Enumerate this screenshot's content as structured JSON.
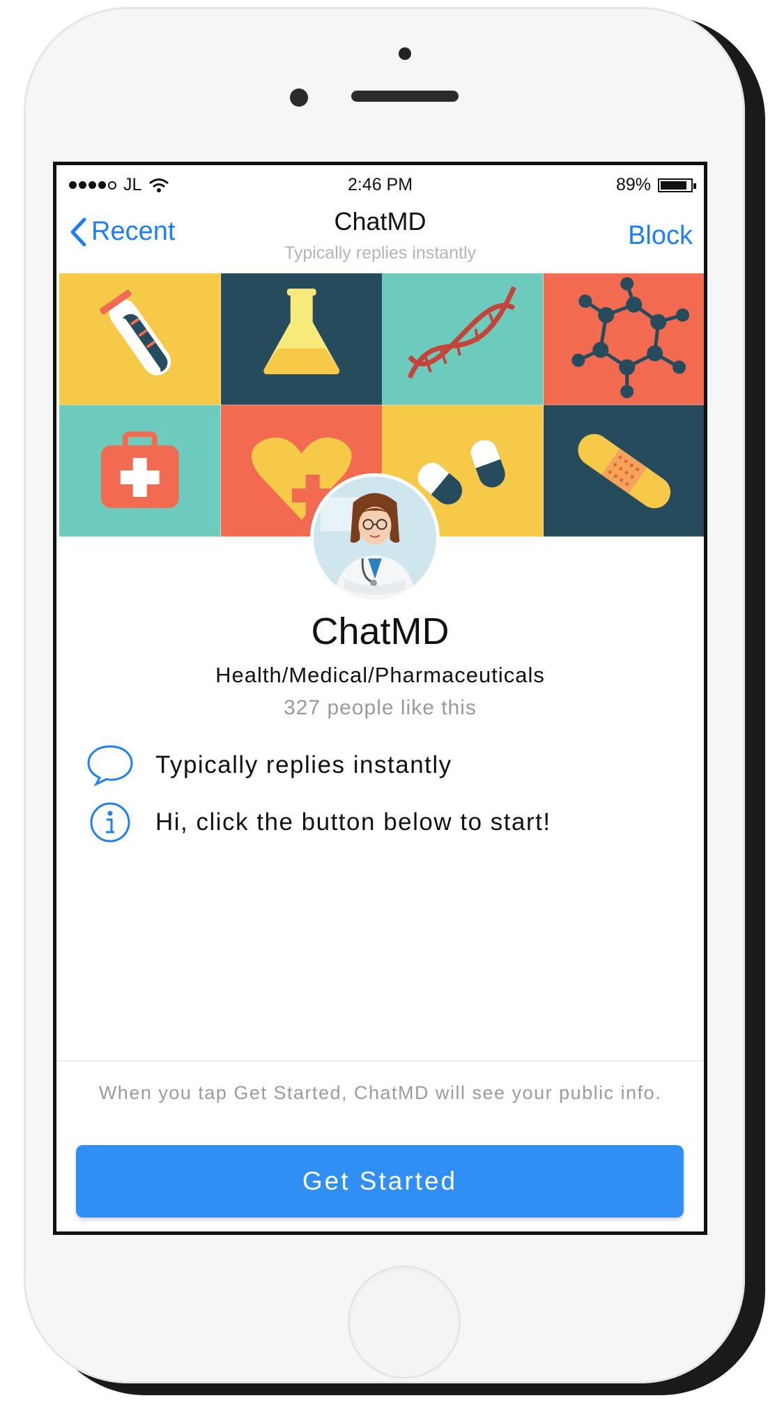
{
  "status_bar": {
    "carrier": "JL",
    "time": "2:46 PM",
    "battery": "89%",
    "battery_level": 0.89
  },
  "nav": {
    "back_label": "Recent",
    "title": "ChatMD",
    "subtitle": "Typically replies instantly",
    "block_label": "Block"
  },
  "cover_tiles": [
    {
      "icon": "test-tube-icon",
      "color": "#f7c948"
    },
    {
      "icon": "flask-icon",
      "color": "#264b5d"
    },
    {
      "icon": "dna-icon",
      "color": "#6dcbbd"
    },
    {
      "icon": "molecule-icon",
      "color": "#f26b50"
    },
    {
      "icon": "first-aid-kit-icon",
      "color": "#6dcbbd"
    },
    {
      "icon": "heart-plus-icon",
      "color": "#f26b50"
    },
    {
      "icon": "pills-icon",
      "color": "#f7c948"
    },
    {
      "icon": "bandage-icon",
      "color": "#264b5d"
    }
  ],
  "profile": {
    "avatar_icon": "doctor-avatar",
    "name": "ChatMD",
    "category": "Health/Medical/Pharmaceuticals",
    "likes": "327 people like this"
  },
  "info_items": [
    {
      "icon": "speech-bubble-icon",
      "text": "Typically replies instantly"
    },
    {
      "icon": "info-icon",
      "text": "Hi, click the button below to start!"
    }
  ],
  "footer": {
    "disclaimer": "When you tap Get Started, ChatMD will see your public info.",
    "button_label": "Get Started"
  },
  "colors": {
    "accent": "#1e7ff5",
    "button": "#2f8ff5"
  }
}
